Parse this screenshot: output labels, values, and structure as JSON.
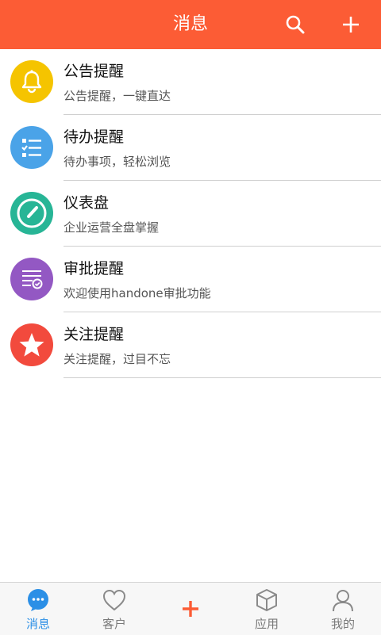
{
  "header": {
    "title": "消息",
    "search_icon": "search-icon",
    "add_icon": "plus-icon",
    "background": "#fc5c35"
  },
  "list": [
    {
      "title": "公告提醒",
      "subtitle": "公告提醒，一键直达",
      "icon": "bell-icon",
      "color": "#f5c400"
    },
    {
      "title": "待办提醒",
      "subtitle": "待办事项，轻松浏览",
      "icon": "checklist-icon",
      "color": "#4aa3e8"
    },
    {
      "title": "仪表盘",
      "subtitle": "企业运营全盘掌握",
      "icon": "gauge-icon",
      "color": "#27b596"
    },
    {
      "title": "审批提醒",
      "subtitle": "欢迎使用handone审批功能",
      "icon": "approval-icon",
      "color": "#9358c3"
    },
    {
      "title": "关注提醒",
      "subtitle": "关注提醒，过目不忘",
      "icon": "star-icon",
      "color": "#f24a3d"
    }
  ],
  "tabbar": [
    {
      "label": "消息",
      "icon": "chat-bubble-icon",
      "active": true,
      "active_color": "#2b8fe6"
    },
    {
      "label": "客户",
      "icon": "heart-icon",
      "active": false
    },
    {
      "label": "",
      "icon": "plus-icon",
      "active": false,
      "color": "#fc5c35"
    },
    {
      "label": "应用",
      "icon": "cube-icon",
      "active": false
    },
    {
      "label": "我的",
      "icon": "person-icon",
      "active": false
    }
  ]
}
